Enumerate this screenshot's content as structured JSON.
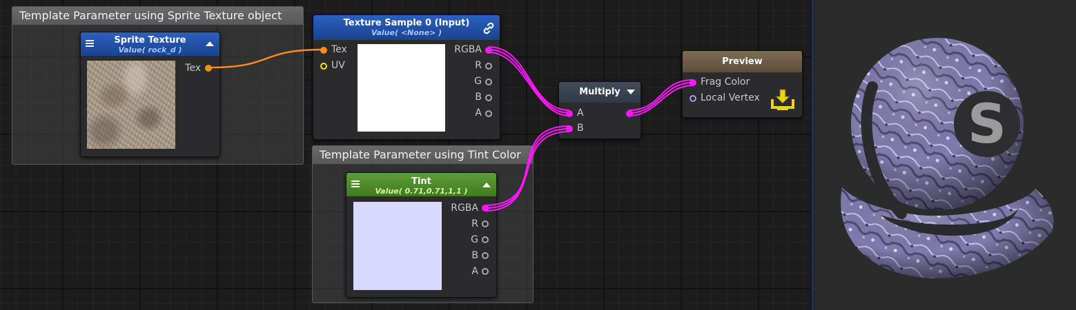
{
  "groups": {
    "sprite_group_title": "Template Parameter using Sprite Texture object",
    "tint_group_title": "Template Parameter using Tint Color"
  },
  "sprite_node": {
    "title": "Sprite Texture",
    "subtitle": "Value( rock_d )",
    "output_label": "Tex"
  },
  "sample_node": {
    "title": "Texture Sample 0 (Input)",
    "subtitle": "Value( <None> )",
    "inputs": [
      "Tex",
      "UV"
    ],
    "outputs": [
      "RGBA",
      "R",
      "G",
      "B",
      "A"
    ]
  },
  "tint_node": {
    "title": "Tint",
    "subtitle": "Value( 0.71,0.71,1,1 )",
    "outputs": [
      "RGBA",
      "R",
      "G",
      "B",
      "A"
    ],
    "swatch_color": "#d9d9ff"
  },
  "multiply_node": {
    "title": "Multiply",
    "inputs": [
      "A",
      "B"
    ]
  },
  "preview_node": {
    "title": "Preview",
    "inputs": [
      "Frag Color",
      "Local Vertex"
    ]
  },
  "colors": {
    "sprite_header": "#1d4a9e",
    "sample_header": "#1d4a9e",
    "tint_header": "#4f8a2c",
    "multiply_header": "#36414e",
    "preview_header": "#6f5d48",
    "wire_texture": "#ff8c1a",
    "wire_rgba": "#ff17ff"
  },
  "icons": {
    "link": "link-icon",
    "menu": "hamburger-menu-icon",
    "collapse": "triangle-up-icon",
    "expand": "triangle-down-icon",
    "apply": "download-tray-icon",
    "logo": "shader-s-logo"
  }
}
